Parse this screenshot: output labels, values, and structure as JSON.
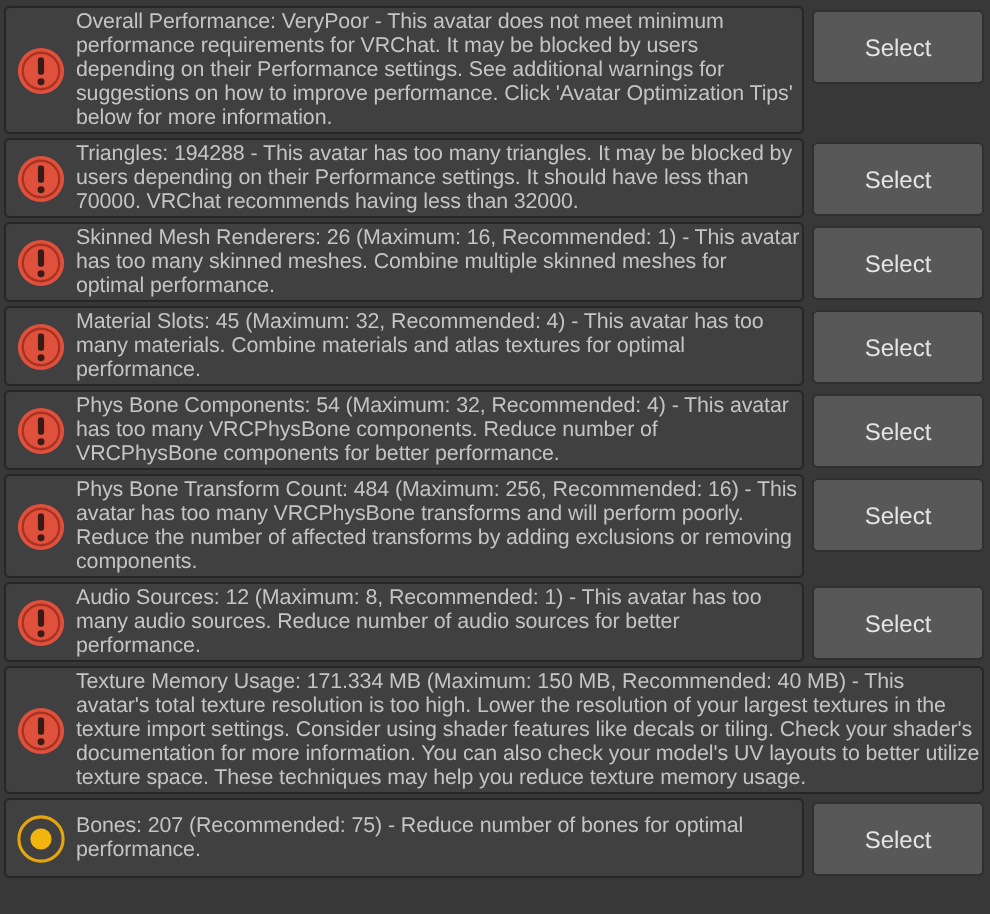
{
  "warnings": [
    {
      "kind": "error",
      "text": "Overall Performance: VeryPoor - This avatar does not meet minimum performance requirements for VRChat. It may be blocked by users depending on their Performance settings. See additional warnings for suggestions on how to improve performance. Click 'Avatar Optimization Tips' below for more information.",
      "button": "Select"
    },
    {
      "kind": "error",
      "text": "Triangles: 194288 - This avatar has too many triangles. It may be blocked by users depending on their Performance settings. It should have less than 70000. VRChat recommends having less than 32000.",
      "button": "Select"
    },
    {
      "kind": "error",
      "text": "Skinned Mesh Renderers: 26 (Maximum: 16, Recommended: 1) - This avatar has too many skinned meshes. Combine multiple skinned meshes for optimal performance.",
      "button": "Select"
    },
    {
      "kind": "error",
      "text": "Material Slots: 45 (Maximum: 32, Recommended: 4) - This avatar has too many materials. Combine materials and atlas textures for optimal performance.",
      "button": "Select"
    },
    {
      "kind": "error",
      "text": "Phys Bone Components: 54 (Maximum: 32, Recommended: 4) - This avatar has too many VRCPhysBone components. Reduce number of VRCPhysBone components for better performance.",
      "button": "Select"
    },
    {
      "kind": "error",
      "text": "Phys Bone Transform Count: 484 (Maximum: 256, Recommended: 16) - This avatar has too many VRCPhysBone transforms and will perform poorly. Reduce the number of affected transforms by adding exclusions or removing components.",
      "button": "Select"
    },
    {
      "kind": "error",
      "text": "Audio Sources: 12 (Maximum: 8, Recommended: 1) - This avatar has too many audio sources. Reduce number of audio sources for better performance.",
      "button": "Select"
    },
    {
      "kind": "error",
      "text": "Texture Memory Usage: 171.334 MB (Maximum: 150 MB, Recommended: 40 MB) - This avatar's total texture resolution is too high. Lower the resolution of your largest textures in the texture import settings. Consider using shader features like decals or tiling. Check your shader's documentation for more information. You can also check your model's UV layouts to better utilize texture space. These techniques may help you reduce texture memory usage."
    },
    {
      "kind": "warning",
      "text": "Bones: 207 (Recommended: 75) - Reduce number of bones for optimal performance.",
      "button": "Select"
    }
  ]
}
